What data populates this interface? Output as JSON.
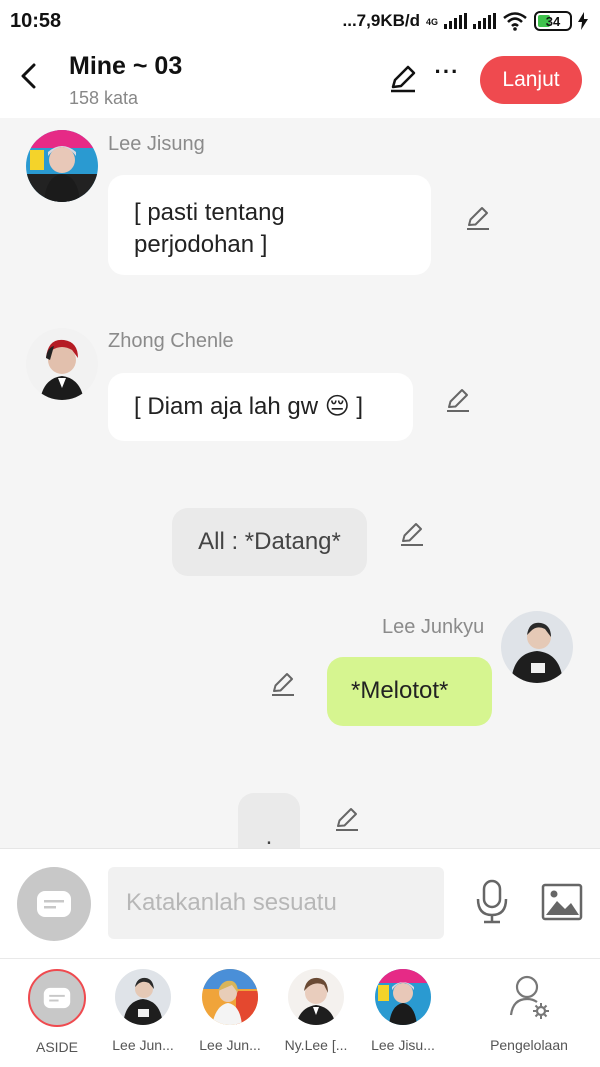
{
  "status_bar": {
    "time": "10:58",
    "network_speed": "...7,9KB/d",
    "network_type": "4G",
    "battery": "34",
    "icons": [
      "signal-icon",
      "signal-icon",
      "wifi-icon",
      "battery-icon",
      "charging-icon"
    ]
  },
  "header": {
    "title": "Mine ~ 03",
    "subtitle": "158 kata",
    "next_label": "Lanjut",
    "icons": [
      "back-arrow-icon",
      "edit-pencil-icon",
      "more-dots-icon"
    ]
  },
  "messages": [
    {
      "speaker": "Lee Jisung",
      "text": "[ pasti tentang perjodohan ]",
      "side": "left"
    },
    {
      "speaker": "Zhong Chenle",
      "text": "[ Diam aja lah gw 😔 ]",
      "side": "left"
    },
    {
      "speaker": "",
      "text": "All : *Datang*",
      "side": "center"
    },
    {
      "speaker": "Lee Junkyu",
      "text": "*Melotot*",
      "side": "right"
    },
    {
      "speaker": "",
      "text": ".",
      "side": "center"
    }
  ],
  "input": {
    "placeholder": "Katakanlah sesuatu",
    "icons": [
      "aside-chat-icon",
      "microphone-icon",
      "image-icon"
    ]
  },
  "tabs": [
    {
      "label": "ASIDE"
    },
    {
      "label": "Lee Jun..."
    },
    {
      "label": "Lee Jun..."
    },
    {
      "label": "Ny.Lee [..."
    },
    {
      "label": "Lee Jisu..."
    },
    {
      "label": "Pengelolaan"
    }
  ],
  "colors": {
    "accent_red": "#ef4a4f",
    "bubble_green": "#d6f590",
    "bubble_white": "#ffffff",
    "bubble_grey": "#eaeaea",
    "background": "#f5f5f5"
  }
}
